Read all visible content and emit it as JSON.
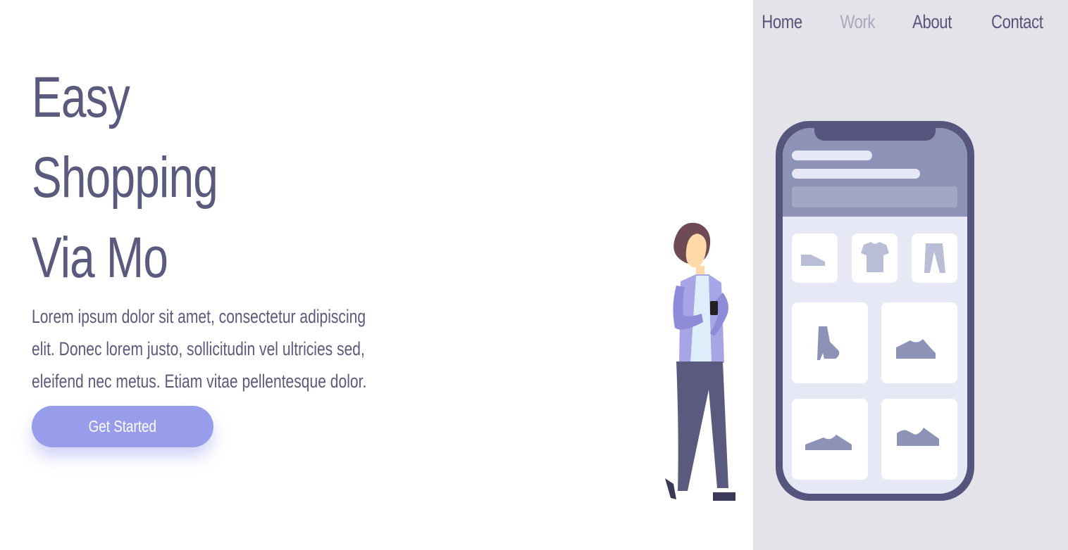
{
  "nav": {
    "items": [
      {
        "label": "Home",
        "active": false
      },
      {
        "label": "Work",
        "active": true
      },
      {
        "label": "About",
        "active": false
      },
      {
        "label": "Contact",
        "active": false
      }
    ]
  },
  "hero": {
    "title_lines": [
      "Easy",
      "Shopping",
      "Via Mo"
    ],
    "body": "Lorem ipsum dolor sit amet, consectetur adipiscing elit. Donec lorem justo, sollicitudin vel ultricies sed, eleifend nec metus. Etiam vitae pellentesque dolor.",
    "cta_label": "Get Started"
  },
  "colors": {
    "text": "#5a5a7e",
    "nav_active": "#a9a8bd",
    "accent": "#979ceb",
    "panel_bg": "#e4e3ea",
    "phone_frame": "#56557d"
  },
  "illustration": {
    "icons": [
      "shoe-icon",
      "tshirt-icon",
      "pants-icon",
      "boot-icon",
      "sneaker-icon",
      "flat-shoe-icon",
      "loafer-icon"
    ]
  }
}
